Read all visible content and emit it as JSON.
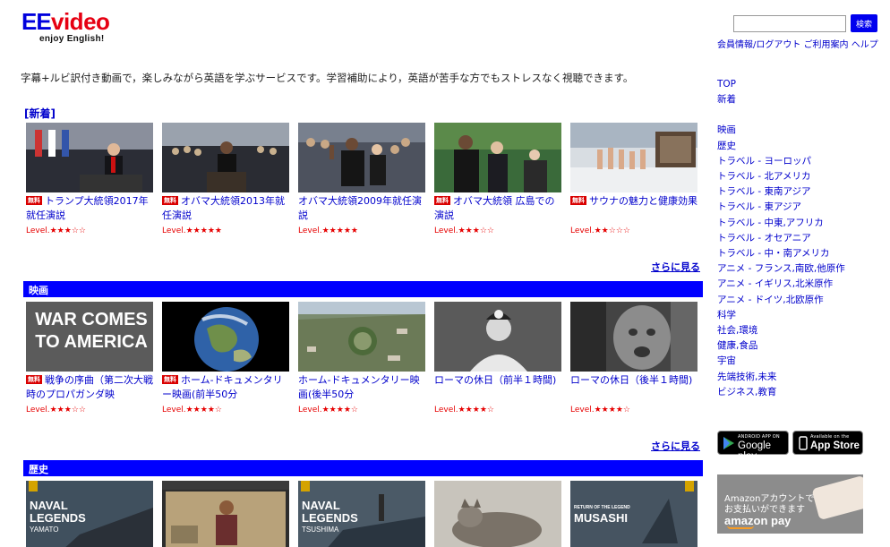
{
  "logo": {
    "ee": "EE",
    "video": "video",
    "tagline": "enjoy English!"
  },
  "search": {
    "placeholder": "",
    "button_label": "検索"
  },
  "top_links": {
    "members": "会員情報/ログアウト",
    "guide": "ご利用案内",
    "help": "ヘルプ"
  },
  "intro": "字幕+ルビ訳付き動画で，楽しみながら英語を学ぶサービスです。学習補助により，英語が苦手な方でもストレスなく視聴できます。",
  "new_section": {
    "heading": "[新着]",
    "more": "さらに見る",
    "items": [
      {
        "free": "無料",
        "title": "トランプ大統領2017年就任演説",
        "level": "Level.★★★☆☆"
      },
      {
        "free": "無料",
        "title": "オバマ大統領2013年就任演説",
        "level": "Level.★★★★★"
      },
      {
        "free": "",
        "title": "オバマ大統領2009年就任演説",
        "level": "Level.★★★★★"
      },
      {
        "free": "無料",
        "title": "オバマ大統領 広島での演説",
        "level": "Level.★★★☆☆"
      },
      {
        "free": "無料",
        "title": "サウナの魅力と健康効果",
        "level": "Level.★★☆☆☆"
      }
    ]
  },
  "movie_section": {
    "heading": "映画",
    "more": "さらに見る",
    "items": [
      {
        "free": "無料",
        "title": "戦争の序曲（第二次大戦時のプロパガンダ映",
        "level": "Level.★★★☆☆",
        "thumb_text": "WAR COMES TO AMERICA"
      },
      {
        "free": "無料",
        "title": "ホーム-ドキュメンタリー映画(前半50分",
        "level": "Level.★★★★☆"
      },
      {
        "free": "",
        "title": "ホーム-ドキュメンタリー映画(後半50分",
        "level": "Level.★★★★☆"
      },
      {
        "free": "",
        "title": "ローマの休日（前半１時間)",
        "level": "Level.★★★★☆"
      },
      {
        "free": "",
        "title": "ローマの休日（後半１時間)",
        "level": "Level.★★★★☆"
      }
    ]
  },
  "history_section": {
    "heading": "歴史",
    "items": [
      {
        "thumb_text_1": "NAVAL",
        "thumb_text_2": "LEGENDS",
        "thumb_text_3": "YAMATO"
      },
      {
        "thumb_text_1": "",
        "thumb_text_2": "",
        "thumb_text_3": ""
      },
      {
        "thumb_text_1": "NAVAL",
        "thumb_text_2": "LEGENDS",
        "thumb_text_3": "TSUSHIMA"
      },
      {
        "thumb_text_1": "",
        "thumb_text_2": "",
        "thumb_text_3": ""
      },
      {
        "thumb_text_1": "RETURN OF THE LEGEND",
        "thumb_text_2": "MUSASHI",
        "thumb_text_3": ""
      }
    ]
  },
  "nav": {
    "group1": [
      "TOP",
      "新着"
    ],
    "group2": [
      "映画",
      "歴史",
      "トラベル - ヨーロッパ",
      "トラベル - 北アメリカ",
      "トラベル - 東南アジア",
      "トラベル - 東アジア",
      "トラベル - 中東,アフリカ",
      "トラベル - オセアニア",
      "トラベル - 中・南アメリカ",
      "アニメ - フランス,南欧,他原作",
      "アニメ - イギリス,北米原作",
      "アニメ - ドイツ,北欧原作",
      "科学",
      "社会,環境",
      "健康,食品",
      "宇宙",
      "先端技術,未来",
      "ビジネス,教育"
    ]
  },
  "stores": {
    "google_small": "ANDROID APP ON",
    "google_big": "Google play",
    "apple_small": "Available on the",
    "apple_big": "App Store"
  },
  "amazon": {
    "line1": "Amazonアカウントで",
    "line2": "お支払いができます",
    "logo": "amazon pay"
  },
  "colors": {
    "accent": "#0000ff",
    "link": "#0000cc",
    "free_badge": "#d90000",
    "level": "#e60000"
  }
}
